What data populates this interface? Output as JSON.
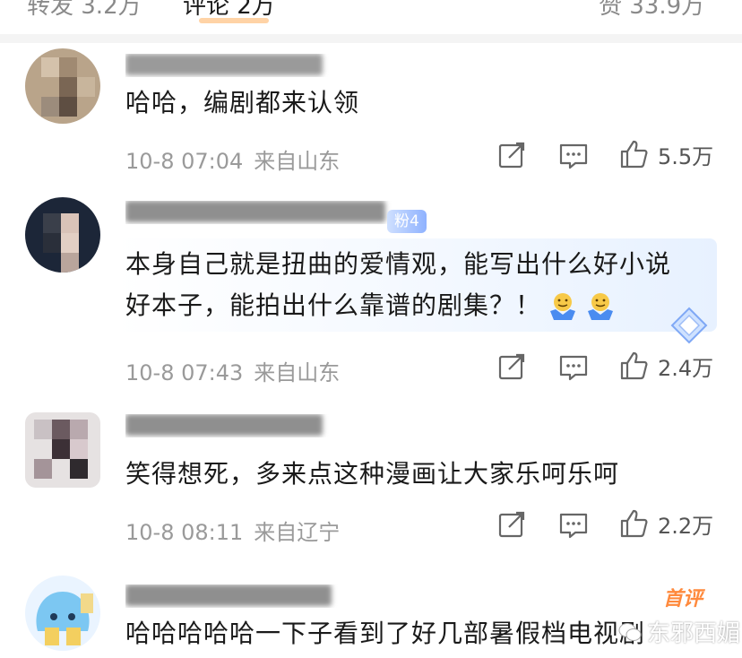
{
  "header": {
    "repost": "转发 3.2万",
    "comments": "评论 2万",
    "likes": "赞 33.9万"
  },
  "comments": [
    {
      "text": "哈哈，编剧都来认领",
      "date": "10-8 07:04",
      "location": "来自山东",
      "like_count": "5.5万"
    },
    {
      "fan_badge": "粉4",
      "text_line1": "本身自己就是扭曲的爱情观，能写出什么好小说",
      "text_line2": "好本子，能拍出什么靠谱的剧集？！",
      "date": "10-8 07:43",
      "location": "来自山东",
      "like_count": "2.4万"
    },
    {
      "text": "笑得想死，多来点这种漫画让大家乐呵乐呵",
      "date": "10-8 08:11",
      "location": "来自辽宁",
      "like_count": "2.2万"
    },
    {
      "first_badge": "首评",
      "text": "哈哈哈哈哈一下子看到了好几部暑假档电视剧"
    }
  ],
  "watermark": "东邪西媚",
  "colors": {
    "accent": "#ff8200",
    "meta": "#9a9a9a",
    "first_badge": "#ff8a3d"
  }
}
